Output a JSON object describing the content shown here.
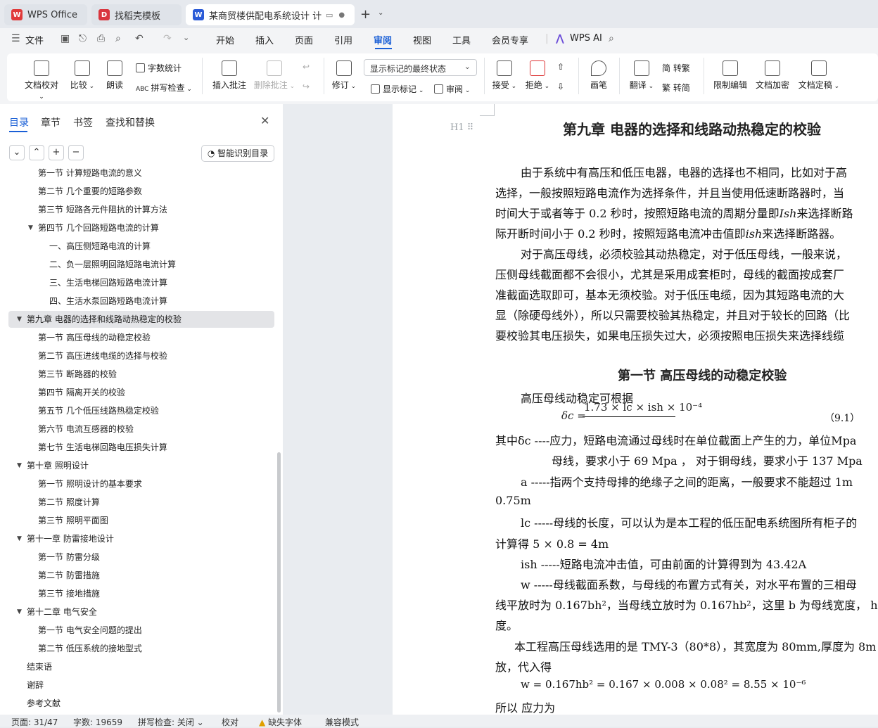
{
  "tabs": [
    {
      "label": "WPS Office"
    },
    {
      "label": "找稻壳模板"
    },
    {
      "label": "某商贸楼供配电系统设计 计算"
    }
  ],
  "menu": {
    "file": "文件",
    "items": [
      "开始",
      "插入",
      "页面",
      "引用",
      "审阅",
      "视图",
      "工具",
      "会员专享"
    ],
    "active": "审阅",
    "ai": "WPS AI"
  },
  "ribbon": {
    "doc_check": "文档校对",
    "compare": "比较",
    "read_aloud": "朗读",
    "word_count": "字数统计",
    "spell_check": "拼写检查",
    "insert_comment": "插入批注",
    "delete_comment": "删除批注",
    "revise": "修订",
    "markup_select": "显示标记的最终状态",
    "show_markup": "显示标记",
    "review": "审阅",
    "accept": "接受",
    "reject": "拒绝",
    "pen": "画笔",
    "translate": "翻译",
    "to_trad": "简 转繁",
    "to_simp": "繁 转简",
    "restrict_edit": "限制编辑",
    "encrypt": "文档加密",
    "finalize": "文档定稿"
  },
  "leftpane": {
    "tabs": [
      "目录",
      "章节",
      "书签",
      "查找和替换"
    ],
    "smart_btn": "智能识别目录",
    "toc": [
      {
        "text": "第一节  计算短路电流的意义",
        "level": 2
      },
      {
        "text": "第二节  几个重要的短路参数",
        "level": 2
      },
      {
        "text": "第三节  短路各元件阻抗的计算方法",
        "level": 2
      },
      {
        "text": "第四节  几个回路短路电流的计算",
        "level": 2,
        "expanded": true
      },
      {
        "text": "一、高压侧短路电流的计算",
        "level": 3
      },
      {
        "text": "二、负一层照明回路短路电流计算",
        "level": 3
      },
      {
        "text": "三、生活电梯回路短路电流计算",
        "level": 3
      },
      {
        "text": "四、生活水泵回路短路电流计算",
        "level": 3
      },
      {
        "text": "第九章  电器的选择和线路动热稳定的校验",
        "level": 1,
        "expanded": true,
        "selected": true
      },
      {
        "text": "第一节  高压母线的动稳定校验",
        "level": 2
      },
      {
        "text": "第二节  高压进线电缆的选择与校验",
        "level": 2
      },
      {
        "text": "第三节  断路器的校验",
        "level": 2
      },
      {
        "text": "第四节  隔离开关的校验",
        "level": 2
      },
      {
        "text": "第五节  几个低压线路热稳定校验",
        "level": 2
      },
      {
        "text": "第六节  电流互感器的校验",
        "level": 2
      },
      {
        "text": "第七节  生活电梯回路电压损失计算",
        "level": 2
      },
      {
        "text": "第十章  照明设计",
        "level": 1,
        "expanded": true
      },
      {
        "text": "第一节  照明设计的基本要求",
        "level": 2
      },
      {
        "text": "第二节  照度计算",
        "level": 2
      },
      {
        "text": "第三节  照明平面图",
        "level": 2
      },
      {
        "text": "第十一章  防雷接地设计",
        "level": 1,
        "expanded": true
      },
      {
        "text": "第一节  防雷分级",
        "level": 2
      },
      {
        "text": "第二节  防雷措施",
        "level": 2
      },
      {
        "text": "第三节  接地措施",
        "level": 2
      },
      {
        "text": "第十二章  电气安全",
        "level": 1,
        "expanded": true
      },
      {
        "text": "第一节  电气安全问题的提出",
        "level": 2
      },
      {
        "text": "第二节  低压系统的接地型式",
        "level": 2
      },
      {
        "text": "结束语",
        "level": 1
      },
      {
        "text": "谢辞",
        "level": 1
      },
      {
        "text": "参考文献",
        "level": 1
      }
    ]
  },
  "doc": {
    "heading_marker": "H1",
    "chapter_title": "第九章  电器的选择和线路动热稳定的校验",
    "p1": [
      "由于系统中有高压和低压电器，电器的选择也不相同，比如对于高",
      "选择，一般按照短路电流作为选择条件，并且当使用低速断路器时，当",
      "时间大于或者等于 0.2 秒时，按照短路电流的周期分量即",
      "来选择断路",
      "际开断时间小于 0.2 秒时，按照短路电流冲击值即",
      "来选择断路器。"
    ],
    "p2": [
      "对于高压母线，必须校验其动热稳定，对于低压母线，一般来说，",
      "压侧母线截面都不会很小，尤其是采用成套柜时，母线的截面按成套厂",
      "准截面选取即可，基本无须校验。对于低压电缆，因为其短路电流的大",
      "显（除硬母线外），所以只需要校验其热稳定，并且对于较长的回路（比",
      "要校验其电压损失，如果电压损失过大，必须按照电压损失来选择线缆"
    ],
    "section_title": "第一节  高压母线的动稳定校验",
    "formula_intro": "高压母线动稳定可根据",
    "formula_lhs": "δc =",
    "formula_num": "1.73 × lc × ish × 10⁻⁴",
    "formula_no": "（9.1）",
    "defs": [
      "其中δc ----应力，短路电流通过母线时在单位截面上产生的力，单位Mpa",
      "母线，要求小于 69 Mpa ， 对于铜母线，要求小于 137 Mpa",
      "a -----指两个支持母排的绝缘子之间的距离，一般要求不能超过 1m",
      "0.75m",
      "lc -----母线的长度，可以认为是本工程的低压配电系统图所有柜子的",
      "计算得 5 × 0.8 = 4m",
      "ish -----短路电流冲击值，可由前面的计算得到为 43.42A",
      "w -----母线截面系数，与母线的布置方式有关，对水平布置的三相母",
      "线平放时为 0.167bh²，当母线立放时为 0.167hb²，这里 b 为母线宽度， h",
      "度。",
      "本工程高压母线选用的是 TMY-3（80*8），其宽度为 80mm,厚度为 8m",
      "放，代入得",
      "w = 0.167hb² = 0.167 × 0.008 × 0.08² = 8.55 × 10⁻⁶",
      "所以  应力为"
    ],
    "ish_symbol": "Ish",
    "ish_small": "ish"
  },
  "status": {
    "page": "页面: 31/47",
    "words": "字数: 19659",
    "spell": "拼写检查: 关闭",
    "proof": "校对",
    "missing_font": "缺失字体",
    "compat": "兼容模式"
  },
  "colors": {
    "accent": "#1a5fd6",
    "wps_red": "#e03a3a",
    "doc_blue": "#2b5bd7"
  }
}
